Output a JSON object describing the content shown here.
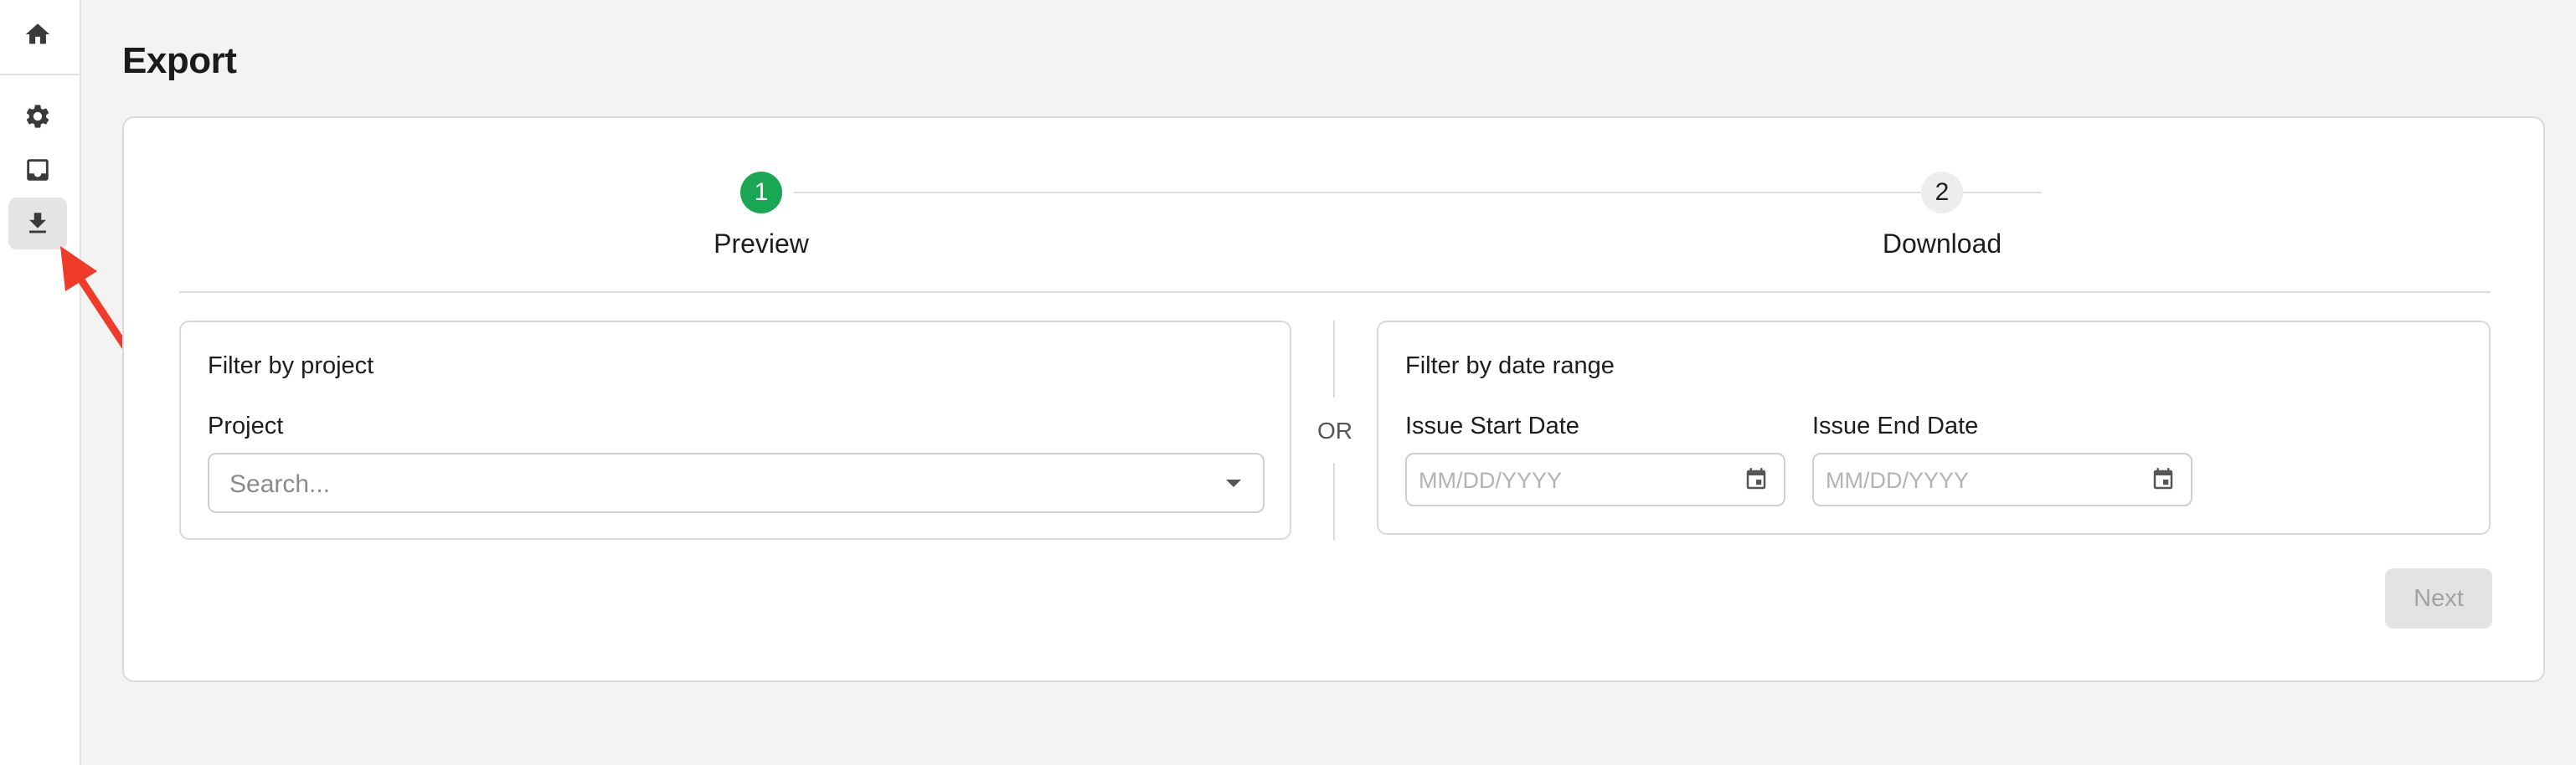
{
  "sidebar": {
    "items": [
      {
        "icon": "home-icon"
      },
      {
        "icon": "gear-icon"
      },
      {
        "icon": "inbox-icon"
      },
      {
        "icon": "download-icon",
        "active": true
      }
    ]
  },
  "page": {
    "title": "Export"
  },
  "stepper": {
    "steps": [
      {
        "number": "1",
        "label": "Preview",
        "active": true
      },
      {
        "number": "2",
        "label": "Download",
        "active": false
      }
    ]
  },
  "filter_project": {
    "title": "Filter by project",
    "field_label": "Project",
    "placeholder": "Search..."
  },
  "separator": {
    "text": "OR"
  },
  "filter_date": {
    "title": "Filter by date range",
    "start_label": "Issue Start Date",
    "start_placeholder": "MM/DD/YYYY",
    "end_label": "Issue End Date",
    "end_placeholder": "MM/DD/YYYY"
  },
  "actions": {
    "next_label": "Next"
  },
  "colors": {
    "active_step": "#1aa753",
    "annotation_arrow": "#f03a2a"
  }
}
